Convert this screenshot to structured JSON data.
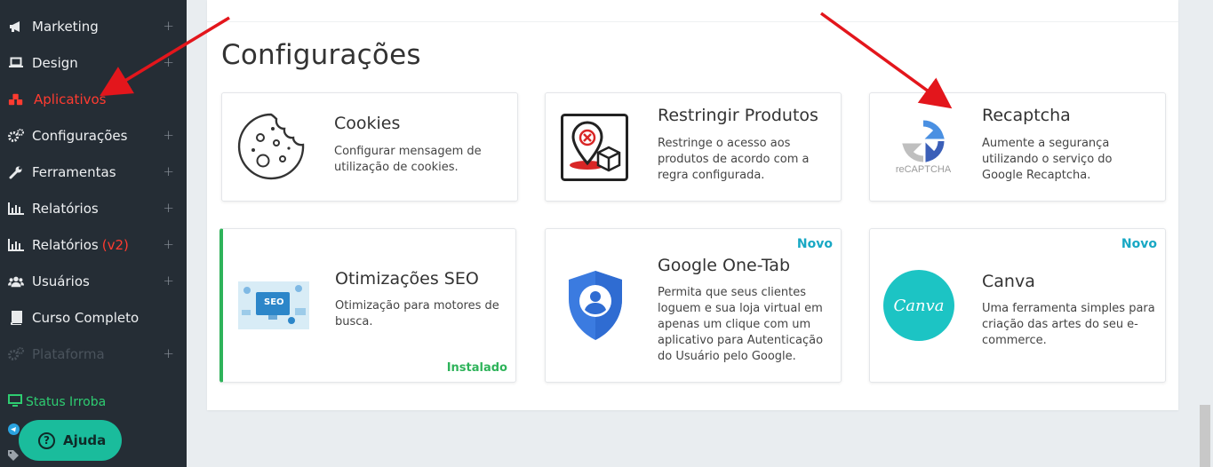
{
  "sidebar": {
    "items": [
      {
        "label": "Marketing",
        "icon": "megaphone-icon"
      },
      {
        "label": "Design",
        "icon": "laptop-icon"
      },
      {
        "label": "Aplicativos",
        "icon": "cubes-icon"
      },
      {
        "label": "Configurações",
        "icon": "cogs-icon"
      },
      {
        "label": "Ferramentas",
        "icon": "wrench-icon"
      },
      {
        "label": "Relatórios",
        "icon": "bar-chart-icon"
      },
      {
        "label": "Relatórios",
        "badge": "(v2)",
        "icon": "bar-chart-icon"
      },
      {
        "label": "Usuários",
        "icon": "users-icon"
      },
      {
        "label": "Curso Completo",
        "icon": "book-icon"
      },
      {
        "label": "Plataforma",
        "icon": "cogs-icon"
      }
    ],
    "status_label": "Status Irroba",
    "help_label": "Ajuda",
    "plus_glyph": "+"
  },
  "main": {
    "title": "Configurações",
    "cards": [
      {
        "title": "Cookies",
        "description": "Configurar mensagem de utilização de cookies.",
        "icon": "cookie-icon"
      },
      {
        "title": "Restringir Produtos",
        "description": "Restringe o acesso aos produtos de acordo com a regra configurada.",
        "icon": "restrict-products-icon"
      },
      {
        "title": "Recaptcha",
        "description": "Aumente a segurança utilizando o serviço do Google Recaptcha.",
        "icon": "recaptcha-icon",
        "icon_text": "reCAPTCHA"
      },
      {
        "title": "Otimizações SEO",
        "description": "Otimização para motores de busca.",
        "icon": "seo-icon",
        "icon_text": "SEO",
        "status": "Instalado"
      },
      {
        "title": "Google One-Tab",
        "description": "Permita que seus clientes loguem e sua loja virtual em apenas um clique com um aplicativo para Autenticação do Usuário pelo Google.",
        "icon": "google-shield-icon",
        "badge": "Novo"
      },
      {
        "title": "Canva",
        "description": "Uma ferramenta simples para criação das artes do seu e-commerce.",
        "icon": "canva-icon",
        "icon_text": "Canva",
        "badge": "Novo"
      }
    ]
  },
  "colors": {
    "sidebar_bg": "#252d35",
    "active": "#ff3b30",
    "status": "#2ecc71",
    "help": "#1abc9c",
    "novo": "#18a8c4",
    "installed": "#2eb35a",
    "annotation_arrow": "#e3161c"
  }
}
